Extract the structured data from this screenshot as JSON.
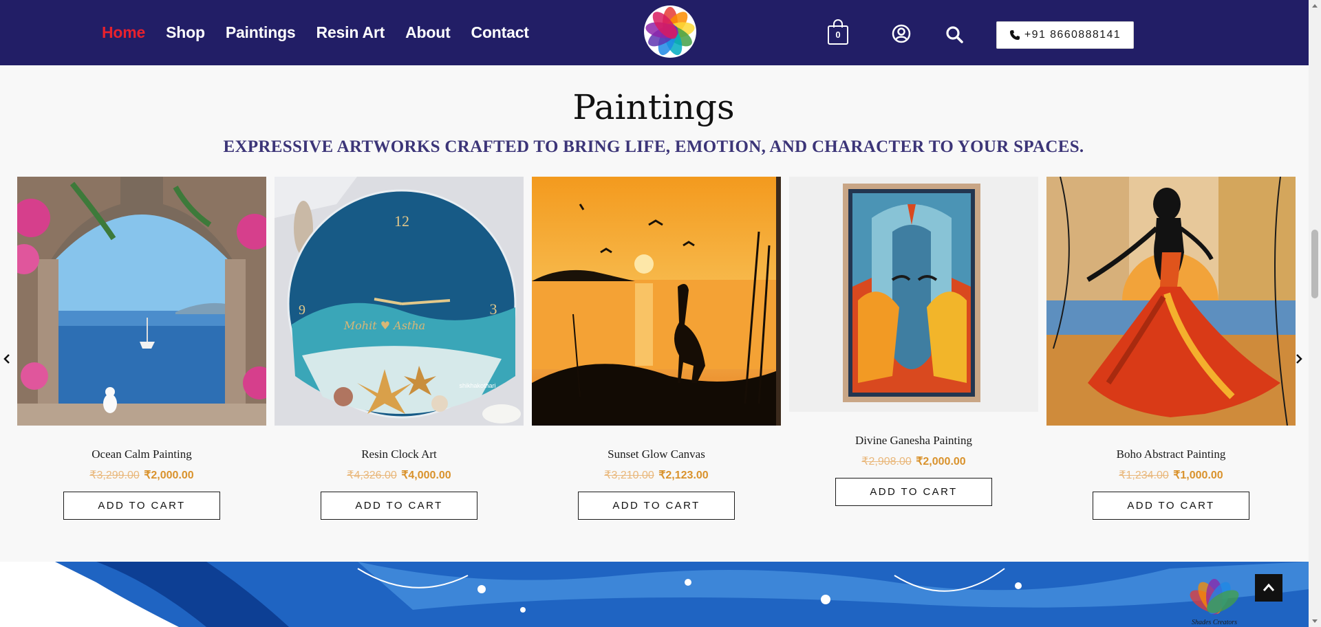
{
  "nav": {
    "items": [
      {
        "label": "Home",
        "active": true
      },
      {
        "label": "Shop"
      },
      {
        "label": "Paintings"
      },
      {
        "label": "Resin Art"
      },
      {
        "label": "About"
      },
      {
        "label": "Contact"
      }
    ]
  },
  "logo": {
    "text": "Shades Creators"
  },
  "cart": {
    "count": "0"
  },
  "phone": {
    "label": "+91 8660888141"
  },
  "section": {
    "title": "Paintings",
    "subtitle": "EXPRESSIVE ARTWORKS CRAFTED TO BRING LIFE, EMOTION, AND CHARACTER TO YOUR SPACES."
  },
  "products": [
    {
      "name": "Ocean Calm Painting",
      "old_price": "₹3,299.00",
      "price": "₹2,000.00",
      "button": "ADD TO CART",
      "image_icon": "ocean-arch-painting"
    },
    {
      "name": "Resin Clock Art",
      "old_price": "₹4,326.00",
      "price": "₹4,000.00",
      "button": "ADD TO CART",
      "image_icon": "resin-clock"
    },
    {
      "name": "Sunset Glow Canvas",
      "old_price": "₹3,210.00",
      "price": "₹2,123.00",
      "button": "ADD TO CART",
      "image_icon": "sunset-heron-painting"
    },
    {
      "name": "Divine Ganesha Painting",
      "old_price": "₹2,908.00",
      "price": "₹2,000.00",
      "button": "ADD TO CART",
      "image_icon": "ganesha-abstract-painting"
    },
    {
      "name": "Boho Abstract Painting",
      "old_price": "₹1,234.00",
      "price": "₹1,000.00",
      "button": "ADD TO CART",
      "image_icon": "boho-dancer-painting"
    }
  ],
  "clock_text": {
    "twelve": "12",
    "three": "3",
    "nine": "9",
    "names": "Mohit ♥ Astha",
    "watermark": "shikhakothari"
  },
  "colors": {
    "header_bg": "#221e66",
    "nav_active": "#e8212d",
    "subtitle": "#3c3578",
    "old_price": "#e9b77a",
    "new_price": "#d9922c"
  }
}
